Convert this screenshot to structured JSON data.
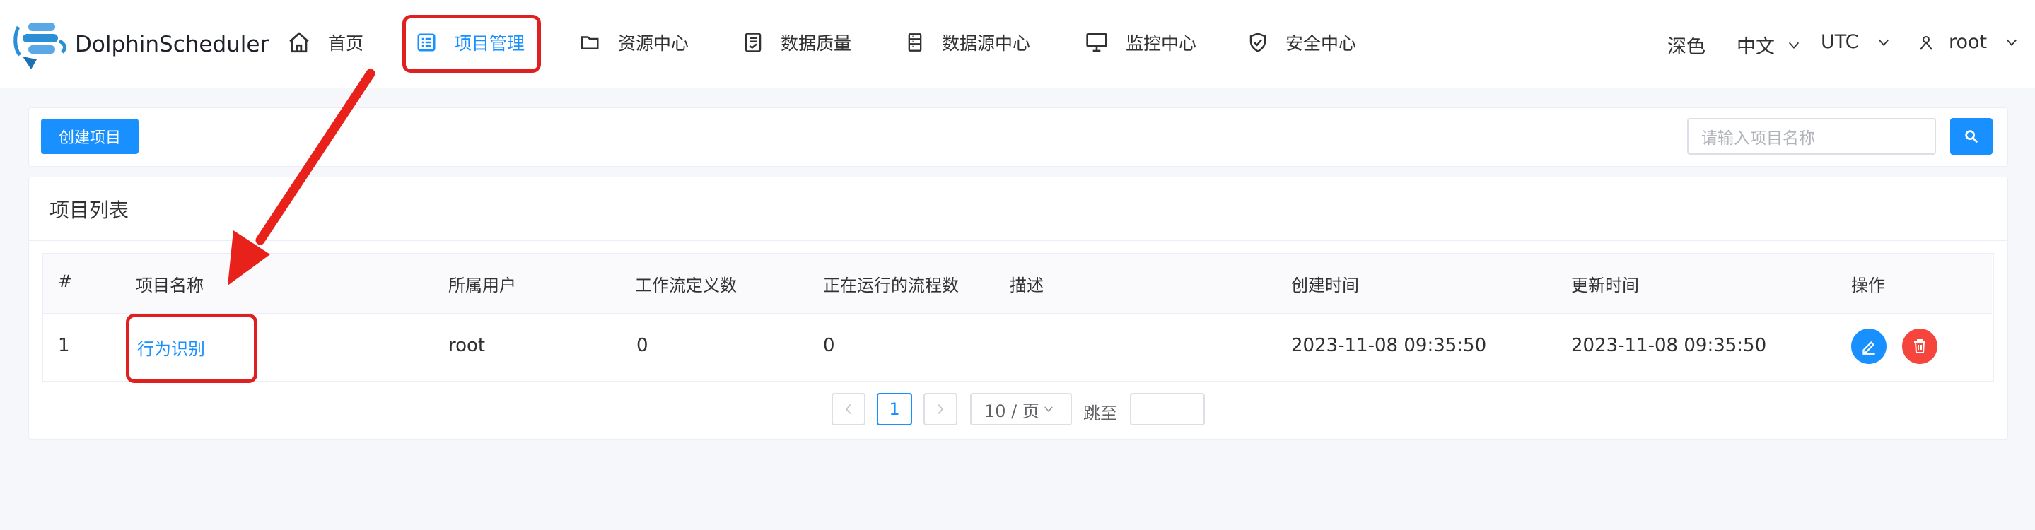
{
  "header": {
    "brand": "DolphinScheduler",
    "nav": [
      {
        "label": "首页",
        "icon": "home-icon"
      },
      {
        "label": "项目管理",
        "icon": "list-icon",
        "active": true
      },
      {
        "label": "资源中心",
        "icon": "folder-icon"
      },
      {
        "label": "数据质量",
        "icon": "document-check-icon"
      },
      {
        "label": "数据源中心",
        "icon": "database-icon"
      },
      {
        "label": "监控中心",
        "icon": "monitor-icon"
      },
      {
        "label": "安全中心",
        "icon": "shield-icon"
      }
    ],
    "theme": "深色",
    "language": "中文",
    "timezone": "UTC",
    "user": "root"
  },
  "toolbar": {
    "create_label": "创建项目",
    "search_placeholder": "请输入项目名称"
  },
  "project_list": {
    "title": "项目列表",
    "columns": [
      "#",
      "项目名称",
      "所属用户",
      "工作流定义数",
      "正在运行的流程数",
      "描述",
      "创建时间",
      "更新时间",
      "操作"
    ],
    "rows": [
      {
        "index": "1",
        "name": "行为识别",
        "owner": "root",
        "workflow_count": "0",
        "running_count": "0",
        "description": "",
        "created": "2023-11-08 09:35:50",
        "updated": "2023-11-08 09:35:50"
      }
    ]
  },
  "pagination": {
    "current_page": "1",
    "page_size": "10 / 页",
    "jump_label": "跳至"
  },
  "colors": {
    "accent": "#1890ff",
    "danger": "#f5453d",
    "annotation": "#e02020"
  }
}
